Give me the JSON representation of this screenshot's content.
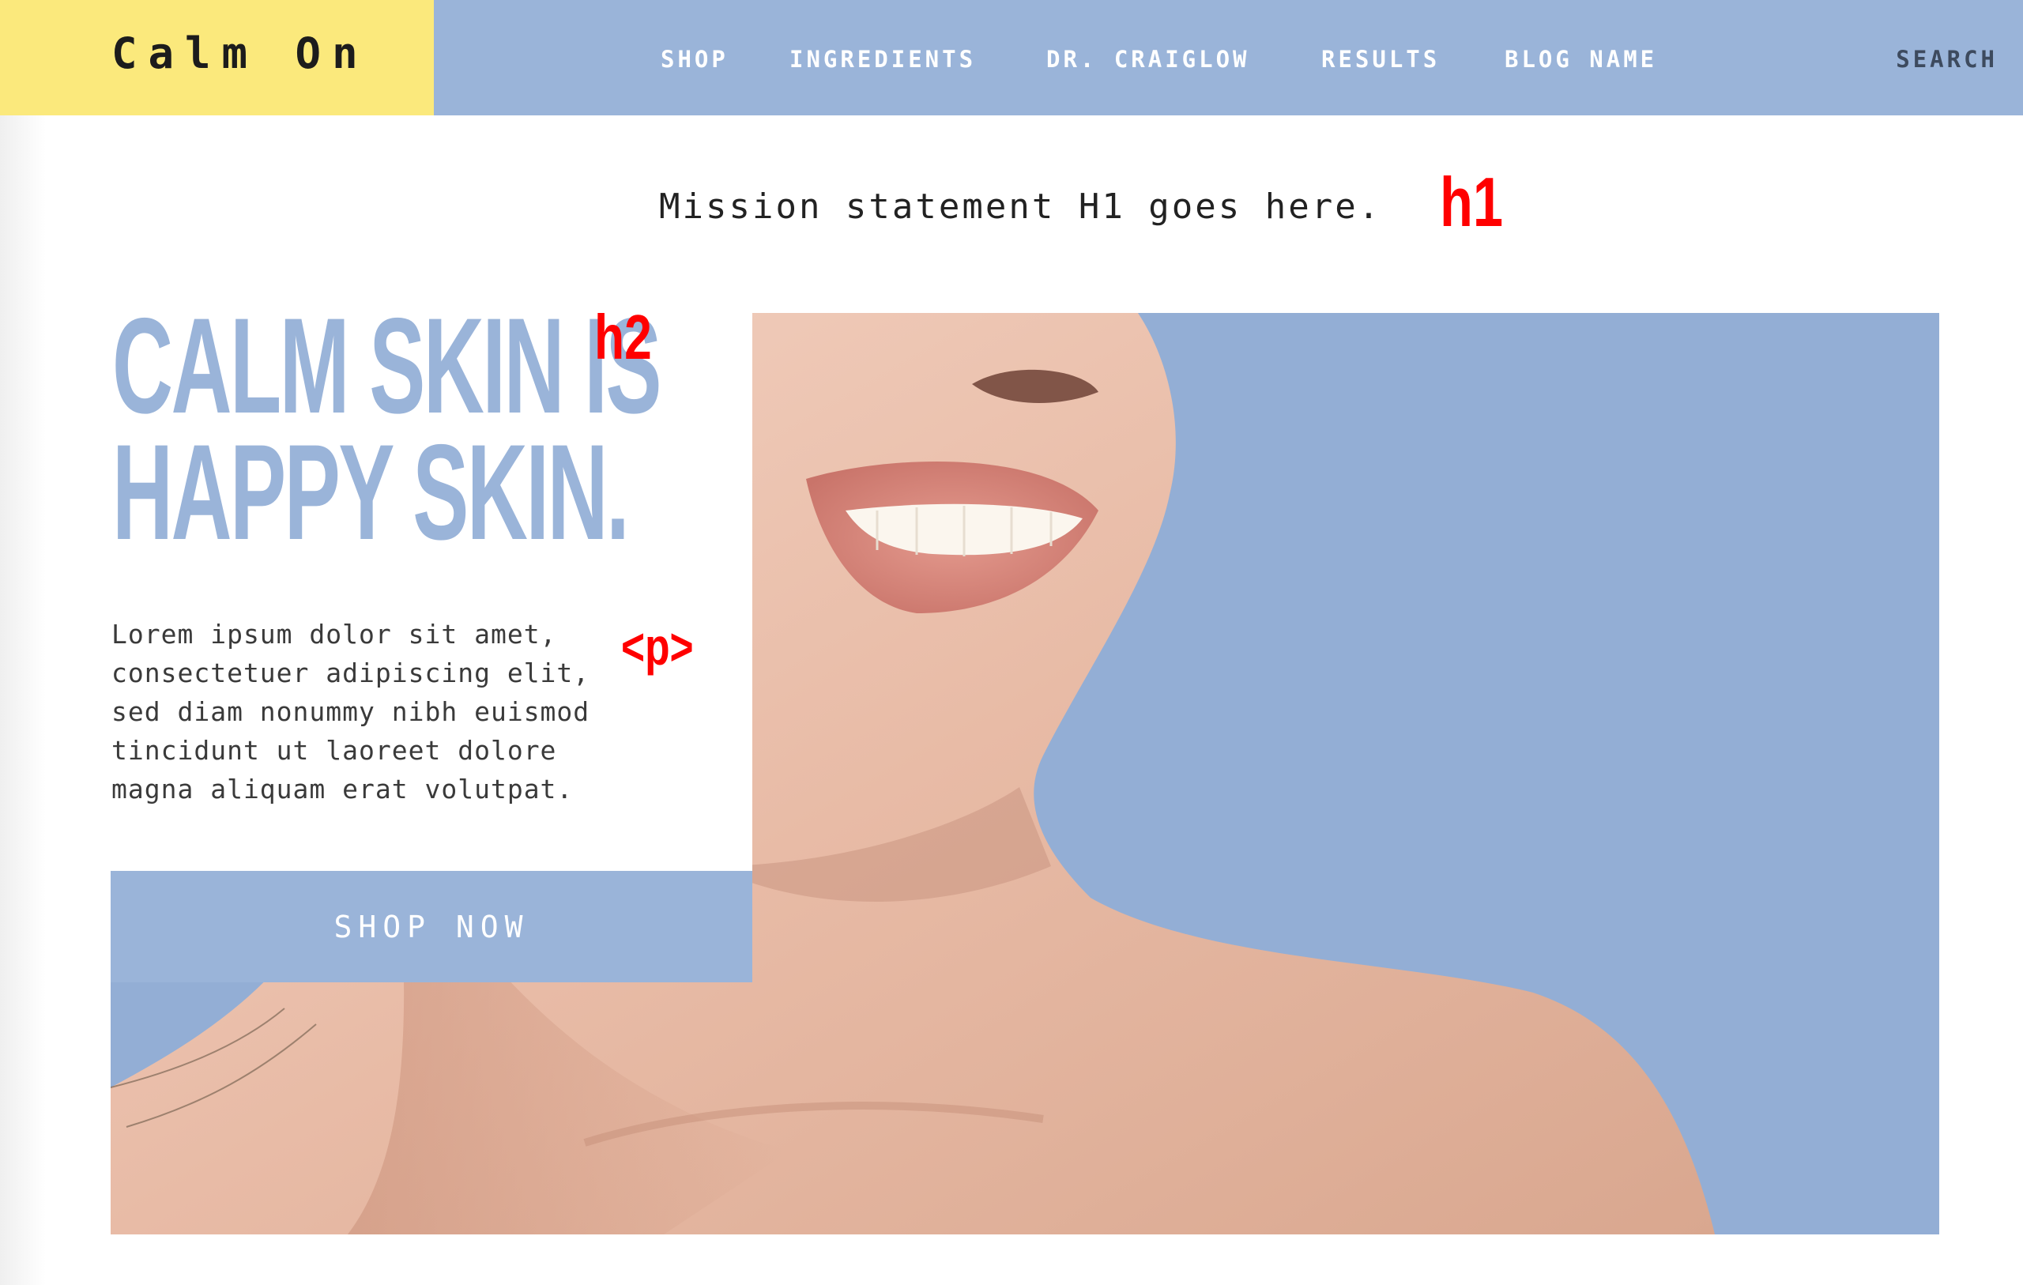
{
  "header": {
    "logo": "Calm On",
    "nav": [
      "SHOP",
      "INGREDIENTS",
      "DR. CRAIGLOW",
      "RESULTS",
      "BLOG NAME"
    ],
    "search_label": "SEARCH"
  },
  "mission": {
    "text": "Mission statement H1 goes here.",
    "tag": "h1"
  },
  "hero": {
    "headline_lines": [
      "CALM SKIN IS",
      "HAPPY SKIN."
    ],
    "headline_tag": "h2",
    "body_lines": [
      "Lorem ipsum dolor sit amet,",
      "consectetuer adipiscing elit,",
      "sed diam nonummy nibh euismod",
      "tincidunt ut laoreet dolore",
      "magna aliquam erat volutpat."
    ],
    "body_tag": "<p>",
    "cta_label": "SHOP NOW"
  },
  "colors": {
    "brand_blue": "#9ab4d9",
    "logo_yellow": "#fbe97c",
    "annotation_red": "#ff0000"
  }
}
